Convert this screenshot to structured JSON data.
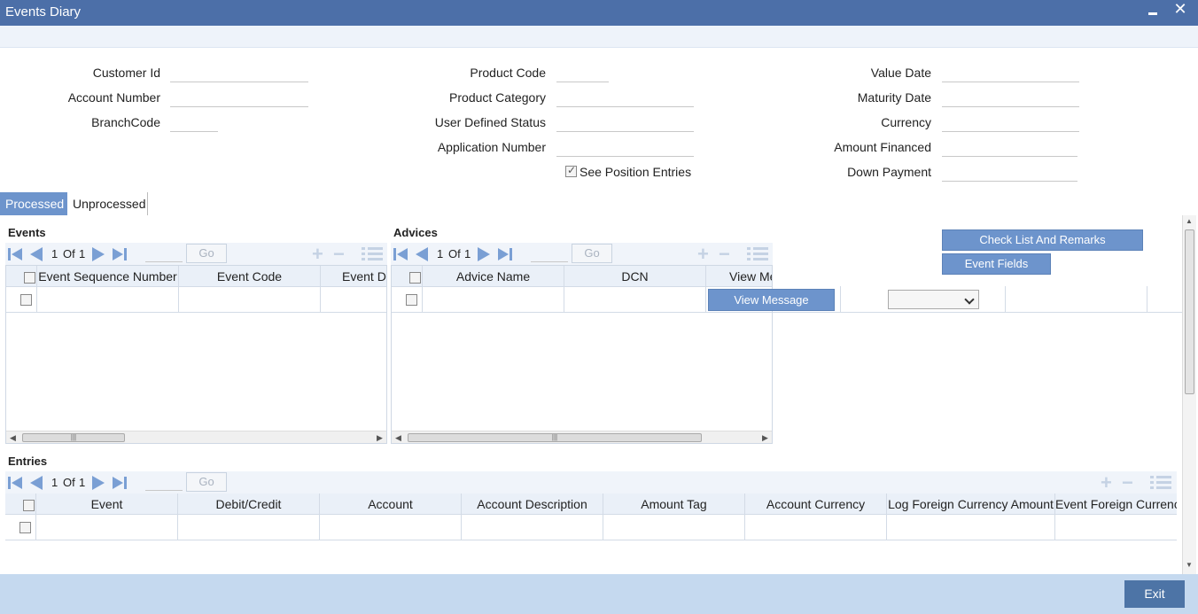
{
  "window": {
    "title": "Events Diary",
    "minimize_label": "",
    "close_label": "✕"
  },
  "form": {
    "customer_id": "Customer Id",
    "account_number": "Account Number",
    "branch_code": "BranchCode",
    "product_code": "Product Code",
    "product_category": "Product Category",
    "user_defined_status": "User Defined Status",
    "application_number": "Application Number",
    "see_position_entries": "See Position Entries",
    "value_date": "Value Date",
    "maturity_date": "Maturity Date",
    "currency": "Currency",
    "amount_financed": "Amount Financed",
    "down_payment": "Down Payment"
  },
  "tabs": {
    "processed": "Processed",
    "unprocessed": "Unprocessed"
  },
  "events": {
    "title": "Events",
    "page": "1",
    "of": "Of",
    "total": "1",
    "go": "Go",
    "columns": [
      "Event Sequence Number",
      "Event Code",
      "Event De"
    ]
  },
  "advices": {
    "title": "Advices",
    "page": "1",
    "of": "Of",
    "total": "1",
    "go": "Go",
    "columns": [
      "Advice Name",
      "DCN",
      "View Me"
    ],
    "view_message": "View Message"
  },
  "buttons": {
    "checklist": "Check List And Remarks",
    "event_fields": "Event Fields",
    "exit": "Exit"
  },
  "entries": {
    "title": "Entries",
    "page": "1",
    "of": "Of",
    "total": "1",
    "go": "Go",
    "columns": [
      "Event",
      "Debit/Credit",
      "Account",
      "Account Description",
      "Amount Tag",
      "Account Currency",
      "Log Foreign Currency Amount",
      "Event Foreign Currency"
    ]
  },
  "icons": {
    "first": "first-page-icon",
    "prev": "previous-page-icon",
    "next": "next-page-icon",
    "last": "last-page-icon"
  },
  "colors": {
    "titlebar": "#4c6fa8",
    "accent": "#6d94cc",
    "footer": "#c5d9ef",
    "exit": "#4d74a6"
  }
}
